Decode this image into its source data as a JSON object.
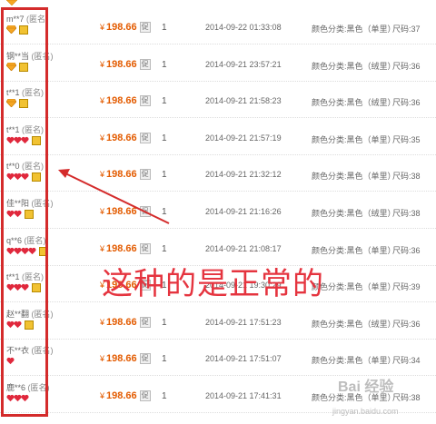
{
  "colors": {
    "price": "#e35b00",
    "heart": "#e0283c",
    "highlight_box": "#d42b2b",
    "annotation": "#e5343f"
  },
  "records": [
    {
      "buyer": "m**7",
      "anon": "(匿名)",
      "rank": [
        "diamond",
        "vip"
      ],
      "price_symbol": "¥",
      "price": "198.66",
      "promo": "促",
      "qty": "1",
      "time": "2014-09-22 01:33:08",
      "spec": "颜色分类:黑色（单里）",
      "size": "尺码:37"
    },
    {
      "buyer": "钢**当",
      "anon": "(匿名)",
      "rank": [
        "diamond",
        "vip"
      ],
      "price_symbol": "¥",
      "price": "198.66",
      "promo": "促",
      "qty": "1",
      "time": "2014-09-21 23:57:21",
      "spec": "颜色分类:黑色（绒里）",
      "size": "尺码:36"
    },
    {
      "buyer": "t**1",
      "anon": "(匿名)",
      "rank": [
        "diamond",
        "vip"
      ],
      "price_symbol": "¥",
      "price": "198.66",
      "promo": "促",
      "qty": "1",
      "time": "2014-09-21 21:58:23",
      "spec": "颜色分类:黑色（绒里）",
      "size": "尺码:36"
    },
    {
      "buyer": "t**1",
      "anon": "(匿名)",
      "rank": [
        "heart",
        "heart",
        "heart",
        "vip"
      ],
      "price_symbol": "¥",
      "price": "198.66",
      "promo": "促",
      "qty": "1",
      "time": "2014-09-21 21:57:19",
      "spec": "颜色分类:黑色（单里）",
      "size": "尺码:35"
    },
    {
      "buyer": "t**0",
      "anon": "(匿名)",
      "rank": [
        "heart",
        "heart",
        "heart",
        "vip"
      ],
      "price_symbol": "¥",
      "price": "198.66",
      "promo": "促",
      "qty": "1",
      "time": "2014-09-21 21:32:12",
      "spec": "颜色分类:黑色（单里）",
      "size": "尺码:38"
    },
    {
      "buyer": "佳**阳",
      "anon": "(匿名)",
      "rank": [
        "heart",
        "heart",
        "vip"
      ],
      "price_symbol": "¥",
      "price": "198.66",
      "promo": "促",
      "qty": "1",
      "time": "2014-09-21 21:16:26",
      "spec": "颜色分类:黑色（绒里）",
      "size": "尺码:38"
    },
    {
      "buyer": "q**6",
      "anon": "(匿名)",
      "rank": [
        "heart",
        "heart",
        "heart",
        "heart",
        "vip"
      ],
      "price_symbol": "¥",
      "price": "198.66",
      "promo": "促",
      "qty": "1",
      "time": "2014-09-21 21:08:17",
      "spec": "颜色分类:黑色（单里）",
      "size": "尺码:36"
    },
    {
      "buyer": "t**1",
      "anon": "(匿名)",
      "rank": [
        "heart",
        "heart",
        "heart",
        "vip"
      ],
      "price_symbol": "¥",
      "price": "198.66",
      "promo": "促",
      "qty": "1",
      "time": "2014-09-21 19:30:29",
      "spec": "颜色分类:黑色（单里）",
      "size": "尺码:39"
    },
    {
      "buyer": "赵**翻",
      "anon": "(匿名)",
      "rank": [
        "heart",
        "heart",
        "vip"
      ],
      "price_symbol": "¥",
      "price": "198.66",
      "promo": "促",
      "qty": "1",
      "time": "2014-09-21 17:51:23",
      "spec": "颜色分类:黑色（绒里）",
      "size": "尺码:36"
    },
    {
      "buyer": "不**衣",
      "anon": "(匿名)",
      "rank": [
        "heart"
      ],
      "price_symbol": "¥",
      "price": "198.66",
      "promo": "促",
      "qty": "1",
      "time": "2014-09-21 17:51:07",
      "spec": "颜色分类:黑色（单里）",
      "size": "尺码:34"
    },
    {
      "buyer": "鹿**6",
      "anon": "(匿名)",
      "rank": [
        "heart",
        "heart",
        "heart"
      ],
      "price_symbol": "¥",
      "price": "198.66",
      "promo": "促",
      "qty": "1",
      "time": "2014-09-21 17:41:31",
      "spec": "颜色分类:黑色（单里）",
      "size": "尺码:38"
    }
  ],
  "annotation": {
    "text": "这种的是正常的"
  },
  "watermark": {
    "text": "Bai 经验",
    "url": "jingyan.baidu.com"
  }
}
